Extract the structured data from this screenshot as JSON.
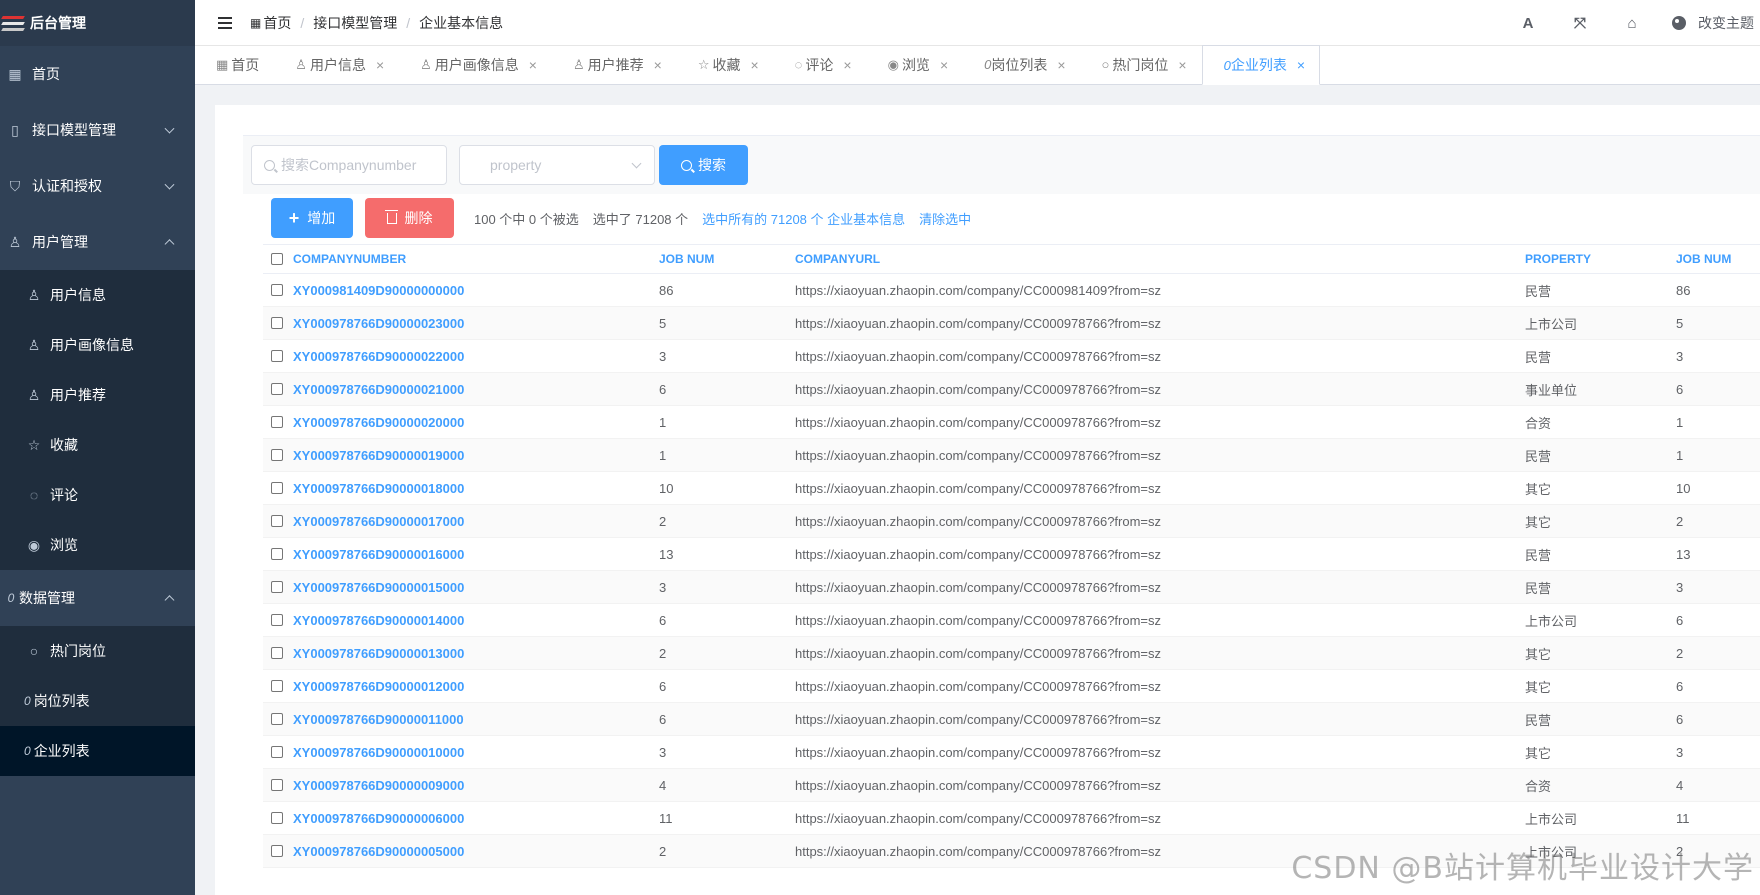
{
  "sidebar": {
    "title": "后台管理",
    "items": [
      {
        "label": "首页",
        "icon": "dashboard-icon"
      },
      {
        "label": "接口模型管理",
        "icon": "document-icon"
      },
      {
        "label": "认证和授权",
        "icon": "shield-icon"
      },
      {
        "label": "用户管理",
        "icon": "user-icon"
      }
    ],
    "user_sub": [
      {
        "label": "用户信息"
      },
      {
        "label": "用户画像信息"
      },
      {
        "label": "用户推荐"
      },
      {
        "label": "收藏"
      },
      {
        "label": "评论"
      },
      {
        "label": "浏览"
      }
    ],
    "data_mgmt": {
      "label": "数据管理",
      "prefix": "0"
    },
    "data_sub": [
      {
        "label": "热门岗位"
      },
      {
        "label": "岗位列表",
        "prefix": "0"
      },
      {
        "label": "企业列表",
        "prefix": "0"
      }
    ]
  },
  "header": {
    "breadcrumb": [
      "首页",
      "接口模型管理",
      "企业基本信息"
    ],
    "theme_label": "改变主题",
    "icons": [
      "font-size-icon",
      "fullscreen-icon",
      "home-icon",
      "palette-icon"
    ]
  },
  "tabs": [
    {
      "label": "首页"
    },
    {
      "label": "用户信息"
    },
    {
      "label": "用户画像信息"
    },
    {
      "label": "用户推荐"
    },
    {
      "label": "收藏"
    },
    {
      "label": "评论"
    },
    {
      "label": "浏览"
    },
    {
      "label": "岗位列表",
      "prefix": "0"
    },
    {
      "label": "热门岗位"
    },
    {
      "label": "企业列表",
      "prefix": "0"
    }
  ],
  "search": {
    "input_placeholder": "搜索Companynumber",
    "select_placeholder": "property",
    "search_label": "搜索"
  },
  "actions": {
    "add_label": "增加",
    "delete_label": "删除",
    "selected_info": "100 个中 0 个被选",
    "selected_total": "选中了 71208 个",
    "select_all_link": "选中所有的 71208 个 企业基本信息",
    "clear_link": "清除选中"
  },
  "table": {
    "headers": [
      "COMPANYNUMBER",
      "JOB NUM",
      "COMPANYURL",
      "PROPERTY",
      "JOB NUM"
    ],
    "rows": [
      [
        "XY000981409D90000000000",
        "86",
        "https://xiaoyuan.zhaopin.com/company/CC000981409?from=sz",
        "民营",
        "86"
      ],
      [
        "XY000978766D90000023000",
        "5",
        "https://xiaoyuan.zhaopin.com/company/CC000978766?from=sz",
        "上市公司",
        "5"
      ],
      [
        "XY000978766D90000022000",
        "3",
        "https://xiaoyuan.zhaopin.com/company/CC000978766?from=sz",
        "民营",
        "3"
      ],
      [
        "XY000978766D90000021000",
        "6",
        "https://xiaoyuan.zhaopin.com/company/CC000978766?from=sz",
        "事业单位",
        "6"
      ],
      [
        "XY000978766D90000020000",
        "1",
        "https://xiaoyuan.zhaopin.com/company/CC000978766?from=sz",
        "合资",
        "1"
      ],
      [
        "XY000978766D90000019000",
        "1",
        "https://xiaoyuan.zhaopin.com/company/CC000978766?from=sz",
        "民营",
        "1"
      ],
      [
        "XY000978766D90000018000",
        "10",
        "https://xiaoyuan.zhaopin.com/company/CC000978766?from=sz",
        "其它",
        "10"
      ],
      [
        "XY000978766D90000017000",
        "2",
        "https://xiaoyuan.zhaopin.com/company/CC000978766?from=sz",
        "其它",
        "2"
      ],
      [
        "XY000978766D90000016000",
        "13",
        "https://xiaoyuan.zhaopin.com/company/CC000978766?from=sz",
        "民营",
        "13"
      ],
      [
        "XY000978766D90000015000",
        "3",
        "https://xiaoyuan.zhaopin.com/company/CC000978766?from=sz",
        "民营",
        "3"
      ],
      [
        "XY000978766D90000014000",
        "6",
        "https://xiaoyuan.zhaopin.com/company/CC000978766?from=sz",
        "上市公司",
        "6"
      ],
      [
        "XY000978766D90000013000",
        "2",
        "https://xiaoyuan.zhaopin.com/company/CC000978766?from=sz",
        "其它",
        "2"
      ],
      [
        "XY000978766D90000012000",
        "6",
        "https://xiaoyuan.zhaopin.com/company/CC000978766?from=sz",
        "其它",
        "6"
      ],
      [
        "XY000978766D90000011000",
        "6",
        "https://xiaoyuan.zhaopin.com/company/CC000978766?from=sz",
        "民营",
        "6"
      ],
      [
        "XY000978766D90000010000",
        "3",
        "https://xiaoyuan.zhaopin.com/company/CC000978766?from=sz",
        "其它",
        "3"
      ],
      [
        "XY000978766D90000009000",
        "4",
        "https://xiaoyuan.zhaopin.com/company/CC000978766?from=sz",
        "合资",
        "4"
      ],
      [
        "XY000978766D90000006000",
        "11",
        "https://xiaoyuan.zhaopin.com/company/CC000978766?from=sz",
        "上市公司",
        "11"
      ],
      [
        "XY000978766D90000005000",
        "2",
        "https://xiaoyuan.zhaopin.com/company/CC000978766?from=sz",
        "上市公司",
        "2"
      ]
    ]
  },
  "watermark": "CSDN @B站计算机毕业设计大学",
  "colors": {
    "sidebar_bg": "#304156",
    "accent": "#409eff",
    "danger": "#f56c6c"
  }
}
